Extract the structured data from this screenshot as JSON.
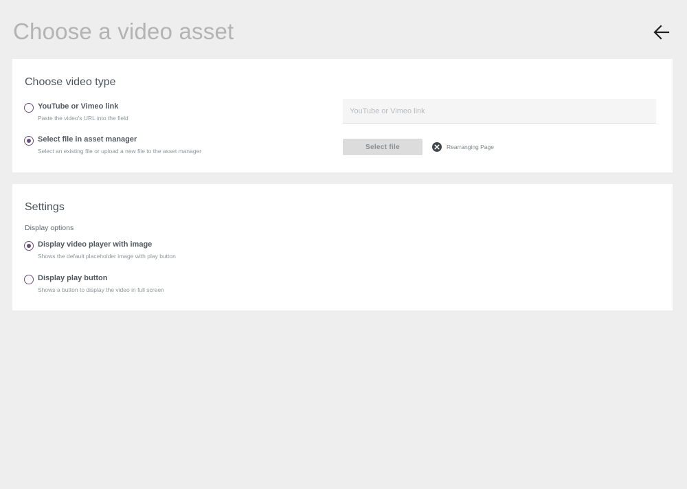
{
  "header": {
    "title": "Choose a video asset",
    "back_icon": "arrow-left-icon"
  },
  "video_type": {
    "title": "Choose video type",
    "options": [
      {
        "label": "YouTube or Vimeo link",
        "description": "Paste the video's URL into the field",
        "selected": false
      },
      {
        "label": "Select file in asset manager",
        "description": "Select an existing file or upload a new file to the asset manager",
        "selected": true
      }
    ],
    "url_input": {
      "placeholder": "YouTube or Vimeo link",
      "value": ""
    },
    "select_file_label": "Select file",
    "selected_file": {
      "name": "Rearranging Page",
      "remove_icon": "close-circle-icon"
    }
  },
  "settings": {
    "title": "Settings",
    "display_options_label": "Display options",
    "options": [
      {
        "label": "Display video player with image",
        "description": "Shows the default placeholder image with play button",
        "selected": true
      },
      {
        "label": "Display play button",
        "description": "Shows a button to display the video in full screen",
        "selected": false
      }
    ]
  },
  "colors": {
    "background": "#eeeeee",
    "card": "#ffffff",
    "radio_accent": "#6c4c7c"
  }
}
